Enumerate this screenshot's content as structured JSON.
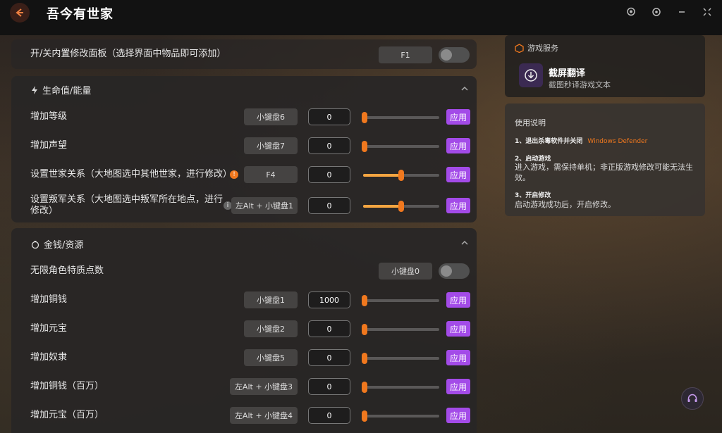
{
  "app": {
    "title": "吾今有世家"
  },
  "top_row": {
    "label": "开/关内置修改面板（选择界面中物品即可添加）",
    "key": "F1"
  },
  "sections": [
    {
      "title": "生命值/能量"
    },
    {
      "title": "金钱/资源"
    }
  ],
  "rows": [
    {
      "label": "增加等级",
      "key": "小键盘6",
      "value": "0",
      "slider": 0.0,
      "apply": "应用"
    },
    {
      "label": "增加声望",
      "key": "小键盘7",
      "value": "0",
      "slider": 0.0,
      "apply": "应用"
    },
    {
      "label": "设置世家关系（大地图选中其他世家，进行修改）",
      "key": "F4",
      "value": "0",
      "slider": 0.5,
      "apply": "应用"
    },
    {
      "label": "设置叛军关系（大地图选中叛军所在地点，进行修改）",
      "key": "左Alt + 小键盘1",
      "value": "0",
      "slider": 0.5,
      "apply": "应用"
    },
    {
      "label": "增加铜钱",
      "key": "小键盘1",
      "value": "1000",
      "slider": 0.0,
      "apply": "应用"
    },
    {
      "label": "增加元宝",
      "key": "小键盘2",
      "value": "0",
      "slider": 0.0,
      "apply": "应用"
    },
    {
      "label": "增加奴隶",
      "key": "小键盘5",
      "value": "0",
      "slider": 0.0,
      "apply": "应用"
    },
    {
      "label": "增加铜钱（百万）",
      "key": "左Alt + 小键盘3",
      "value": "0",
      "slider": 0.0,
      "apply": "应用"
    },
    {
      "label": "增加元宝（百万）",
      "key": "左Alt + 小键盘4",
      "value": "0",
      "slider": 0.0,
      "apply": "应用"
    }
  ],
  "toggle_row": {
    "label": "无限角色特质点数",
    "key": "小键盘0"
  },
  "service": {
    "header": "游戏服务",
    "name": "截屏翻译",
    "desc": "截图秒译游戏文本"
  },
  "instructions": {
    "title": "使用说明",
    "step1": "1、退出杀毒软件并关闭",
    "step1_highlight": "Windows Defender",
    "step2_title": "2、启动游戏",
    "step2_body": "进入游戏，需保持单机；非正版游戏修改可能无法生效。",
    "step3_title": "3、开启修改",
    "step3_body": "启动游戏成功后，开启修改。"
  },
  "colors": {
    "accent": "#a34be8",
    "slider": "#f5a541",
    "highlight": "#f0781e"
  }
}
